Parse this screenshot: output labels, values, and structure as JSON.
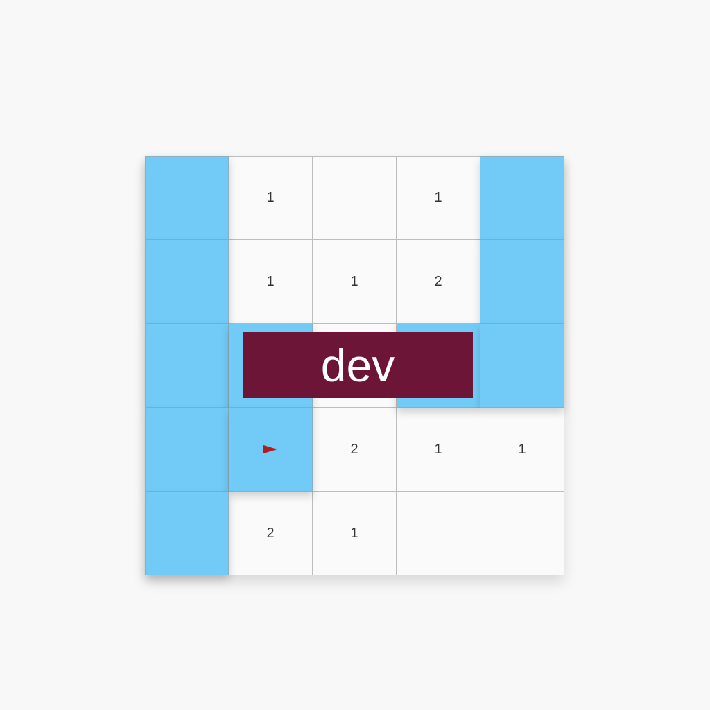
{
  "board": {
    "covered_color": "#72cbf7",
    "revealed_color": "#fafafa",
    "cells": [
      [
        {
          "state": "covered",
          "value": ""
        },
        {
          "state": "revealed",
          "value": "1"
        },
        {
          "state": "revealed",
          "value": ""
        },
        {
          "state": "revealed",
          "value": "1"
        },
        {
          "state": "covered",
          "value": ""
        }
      ],
      [
        {
          "state": "covered",
          "value": ""
        },
        {
          "state": "revealed",
          "value": "1"
        },
        {
          "state": "revealed",
          "value": "1"
        },
        {
          "state": "revealed",
          "value": "2"
        },
        {
          "state": "covered",
          "value": ""
        }
      ],
      [
        {
          "state": "covered",
          "value": ""
        },
        {
          "state": "covered",
          "value": ""
        },
        {
          "state": "revealed",
          "value": ""
        },
        {
          "state": "covered",
          "value": ""
        },
        {
          "state": "covered",
          "value": ""
        }
      ],
      [
        {
          "state": "covered",
          "value": ""
        },
        {
          "state": "flagged",
          "value": "",
          "icon": "flag-icon"
        },
        {
          "state": "revealed",
          "value": "2"
        },
        {
          "state": "revealed",
          "value": "1"
        },
        {
          "state": "revealed",
          "value": "1"
        }
      ],
      [
        {
          "state": "covered",
          "value": ""
        },
        {
          "state": "revealed",
          "value": "2"
        },
        {
          "state": "revealed",
          "value": "1"
        },
        {
          "state": "revealed",
          "value": ""
        },
        {
          "state": "revealed",
          "value": ""
        }
      ]
    ]
  },
  "banner": {
    "label": "dev",
    "color": "#6d1536"
  }
}
